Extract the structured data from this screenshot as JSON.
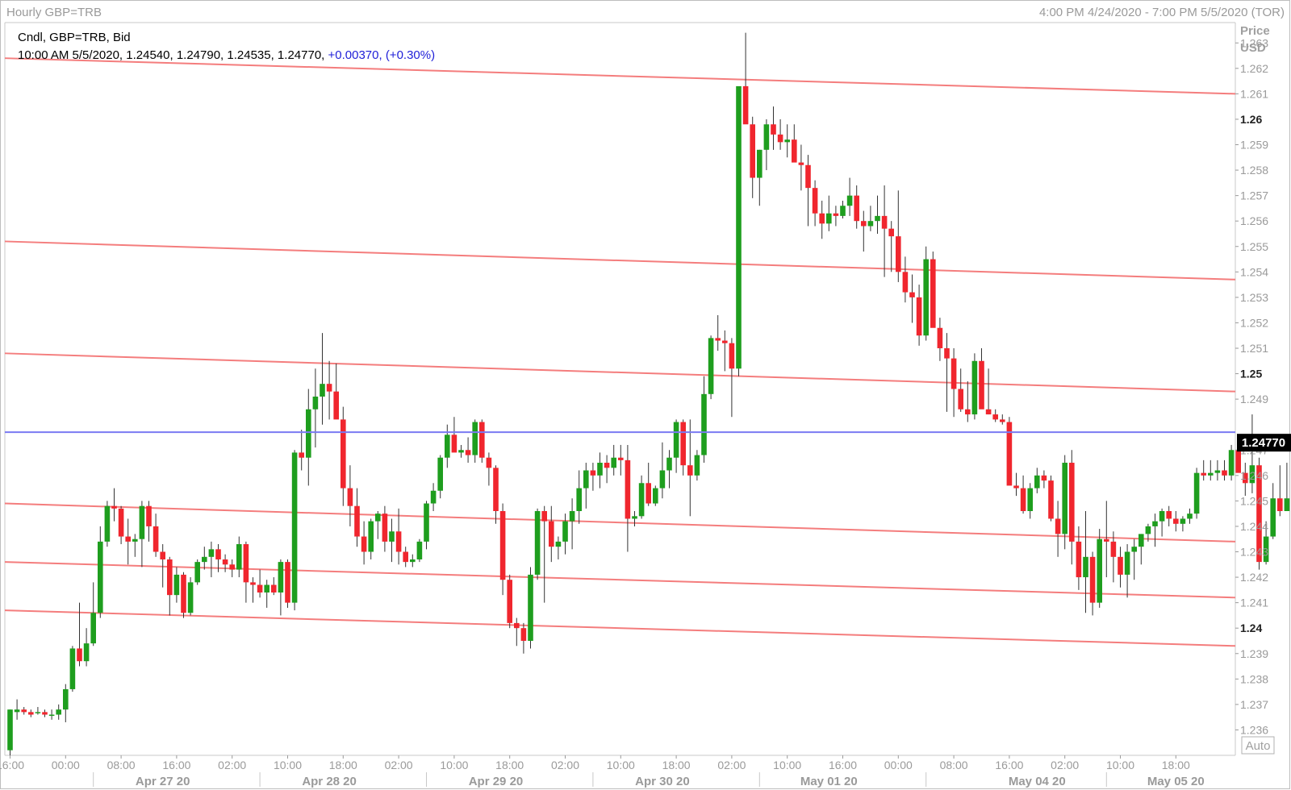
{
  "window": {
    "title": "Hourly GBP=TRB",
    "range": "4:00 PM 4/24/2020 - 7:00 PM 5/5/2020 (TOR)"
  },
  "legend": {
    "line1": "Cndl, GBP=TRB, Bid",
    "line2_prefix": "10:00 AM 5/5/2020, 1.24540, 1.24790, 1.24535, 1.24770, ",
    "change": "+0.00370, (+0.30%)"
  },
  "price_axis": {
    "title": "Price",
    "unit": "USD",
    "last_price_label": "1.24770",
    "auto_button": "Auto"
  },
  "colors": {
    "up": "#1e9e1e",
    "down": "#f0262e",
    "trendline": "#f47d7d",
    "last_price_line": "#7a7af2",
    "grid_text": "#808080",
    "change_text": "#1f1fd8"
  },
  "chart_data": {
    "type": "candlestick",
    "interval": "hourly",
    "instrument": "GBP=TRB",
    "ylim": [
      1.235,
      1.2638
    ],
    "y_ticks": [
      {
        "v": 1.263,
        "label": "1.263"
      },
      {
        "v": 1.262,
        "label": "1.262"
      },
      {
        "v": 1.261,
        "label": "1.261"
      },
      {
        "v": 1.26,
        "label": "1.26",
        "bold": true
      },
      {
        "v": 1.259,
        "label": "1.259"
      },
      {
        "v": 1.258,
        "label": "1.258"
      },
      {
        "v": 1.257,
        "label": "1.257"
      },
      {
        "v": 1.256,
        "label": "1.256"
      },
      {
        "v": 1.255,
        "label": "1.255"
      },
      {
        "v": 1.254,
        "label": "1.254"
      },
      {
        "v": 1.253,
        "label": "1.253"
      },
      {
        "v": 1.252,
        "label": "1.252"
      },
      {
        "v": 1.251,
        "label": "1.251"
      },
      {
        "v": 1.25,
        "label": "1.25",
        "bold": true
      },
      {
        "v": 1.249,
        "label": "1.249"
      },
      {
        "v": 1.247,
        "label": "1.247"
      },
      {
        "v": 1.246,
        "label": "1.246"
      },
      {
        "v": 1.245,
        "label": "1.245"
      },
      {
        "v": 1.244,
        "label": "1.244"
      },
      {
        "v": 1.243,
        "label": "1.243"
      },
      {
        "v": 1.242,
        "label": "1.242"
      },
      {
        "v": 1.241,
        "label": "1.241"
      },
      {
        "v": 1.24,
        "label": "1.24",
        "bold": true
      },
      {
        "v": 1.239,
        "label": "1.239"
      },
      {
        "v": 1.238,
        "label": "1.238"
      },
      {
        "v": 1.237,
        "label": "1.237"
      },
      {
        "v": 1.236,
        "label": "1.236"
      }
    ],
    "x_ticks": [
      {
        "i": 0,
        "label": "16:00"
      },
      {
        "i": 8,
        "label": "00:00"
      },
      {
        "i": 16,
        "label": "08:00"
      },
      {
        "i": 24,
        "label": "16:00"
      },
      {
        "i": 32,
        "label": "02:00"
      },
      {
        "i": 40,
        "label": "10:00"
      },
      {
        "i": 48,
        "label": "18:00"
      },
      {
        "i": 56,
        "label": "02:00"
      },
      {
        "i": 64,
        "label": "10:00"
      },
      {
        "i": 72,
        "label": "18:00"
      },
      {
        "i": 80,
        "label": "02:00"
      },
      {
        "i": 88,
        "label": "10:00"
      },
      {
        "i": 96,
        "label": "18:00"
      },
      {
        "i": 104,
        "label": "02:00"
      },
      {
        "i": 112,
        "label": "10:00"
      },
      {
        "i": 120,
        "label": "16:00"
      },
      {
        "i": 128,
        "label": "00:00"
      },
      {
        "i": 136,
        "label": "08:00"
      },
      {
        "i": 144,
        "label": "16:00"
      },
      {
        "i": 152,
        "label": "02:00"
      },
      {
        "i": 160,
        "label": "10:00"
      },
      {
        "i": 168,
        "label": "18:00"
      }
    ],
    "date_labels": [
      {
        "i": 22,
        "label": "Apr 27 20"
      },
      {
        "i": 46,
        "label": "Apr 28 20"
      },
      {
        "i": 70,
        "label": "Apr 29 20"
      },
      {
        "i": 94,
        "label": "Apr 30 20"
      },
      {
        "i": 118,
        "label": "May 01 20"
      },
      {
        "i": 148,
        "label": "May 04 20"
      },
      {
        "i": 168,
        "label": "May 05 20"
      }
    ],
    "day_separators": [
      12,
      36,
      60,
      84,
      108,
      132,
      158
    ],
    "last_price": 1.2477,
    "trendlines": [
      {
        "y1": 1.2624,
        "y2": 1.261
      },
      {
        "y1": 1.2552,
        "y2": 1.2537
      },
      {
        "y1": 1.2508,
        "y2": 1.2493
      },
      {
        "y1": 1.2449,
        "y2": 1.2434
      },
      {
        "y1": 1.2426,
        "y2": 1.2412
      },
      {
        "y1": 1.2407,
        "y2": 1.2393
      }
    ],
    "candles": [
      [
        1.2352,
        1.2368,
        1.235,
        1.2368
      ],
      [
        1.2367,
        1.2372,
        1.2364,
        1.2368
      ],
      [
        1.2368,
        1.2369,
        1.2366,
        1.2367
      ],
      [
        1.2367,
        1.2368,
        1.2365,
        1.2366
      ],
      [
        1.2367,
        1.2369,
        1.2366,
        1.2367
      ],
      [
        1.2367,
        1.2368,
        1.2365,
        1.2366
      ],
      [
        1.2366,
        1.2368,
        1.2364,
        1.2366
      ],
      [
        1.2366,
        1.237,
        1.2364,
        1.2368
      ],
      [
        1.2368,
        1.2378,
        1.2363,
        1.2376
      ],
      [
        1.2376,
        1.2393,
        1.2375,
        1.2392
      ],
      [
        1.2392,
        1.241,
        1.2385,
        1.2387
      ],
      [
        1.2387,
        1.24,
        1.2385,
        1.2394
      ],
      [
        1.2394,
        1.2418,
        1.2393,
        1.2406
      ],
      [
        1.2406,
        1.244,
        1.2404,
        1.2434
      ],
      [
        1.2434,
        1.245,
        1.2432,
        1.2448
      ],
      [
        1.2448,
        1.2455,
        1.2442,
        1.2447
      ],
      [
        1.2447,
        1.2448,
        1.2433,
        1.2436
      ],
      [
        1.2436,
        1.2443,
        1.2425,
        1.2434
      ],
      [
        1.2434,
        1.2437,
        1.2428,
        1.2435
      ],
      [
        1.2435,
        1.245,
        1.2424,
        1.2448
      ],
      [
        1.2448,
        1.245,
        1.2434,
        1.244
      ],
      [
        1.244,
        1.2445,
        1.2428,
        1.243
      ],
      [
        1.243,
        1.2433,
        1.2416,
        1.2427
      ],
      [
        1.2427,
        1.2428,
        1.2405,
        1.2413
      ],
      [
        1.2413,
        1.2424,
        1.241,
        1.2421
      ],
      [
        1.2421,
        1.2422,
        1.2404,
        1.2406
      ],
      [
        1.2406,
        1.242,
        1.2405,
        1.2418
      ],
      [
        1.2418,
        1.2427,
        1.2417,
        1.2426
      ],
      [
        1.2426,
        1.2432,
        1.2423,
        1.2428
      ],
      [
        1.2428,
        1.2434,
        1.242,
        1.2431
      ],
      [
        1.2431,
        1.2433,
        1.2422,
        1.2427
      ],
      [
        1.2427,
        1.2429,
        1.2422,
        1.2425
      ],
      [
        1.2425,
        1.2427,
        1.242,
        1.2423
      ],
      [
        1.2423,
        1.2436,
        1.242,
        1.2433
      ],
      [
        1.2433,
        1.2434,
        1.241,
        1.2418
      ],
      [
        1.2418,
        1.242,
        1.241,
        1.2417
      ],
      [
        1.2417,
        1.2423,
        1.2412,
        1.2414
      ],
      [
        1.2414,
        1.2419,
        1.2408,
        1.2417
      ],
      [
        1.2417,
        1.242,
        1.2413,
        1.2414
      ],
      [
        1.2414,
        1.2427,
        1.2405,
        1.2426
      ],
      [
        1.2426,
        1.2427,
        1.2408,
        1.241
      ],
      [
        1.241,
        1.247,
        1.2407,
        1.2469
      ],
      [
        1.2469,
        1.2478,
        1.2462,
        1.2467
      ],
      [
        1.2467,
        1.2494,
        1.2456,
        1.2486
      ],
      [
        1.2486,
        1.2502,
        1.2471,
        1.2491
      ],
      [
        1.2491,
        1.2516,
        1.248,
        1.2496
      ],
      [
        1.2496,
        1.2505,
        1.2482,
        1.2493
      ],
      [
        1.2493,
        1.2504,
        1.2486,
        1.2482
      ],
      [
        1.2482,
        1.2487,
        1.2448,
        1.2455
      ],
      [
        1.2455,
        1.2464,
        1.244,
        1.2448
      ],
      [
        1.2448,
        1.2455,
        1.2432,
        1.2436
      ],
      [
        1.2436,
        1.2442,
        1.2425,
        1.243
      ],
      [
        1.243,
        1.2443,
        1.2427,
        1.2442
      ],
      [
        1.2442,
        1.2446,
        1.2435,
        1.2445
      ],
      [
        1.2445,
        1.2448,
        1.243,
        1.2434
      ],
      [
        1.2434,
        1.2443,
        1.2426,
        1.2438
      ],
      [
        1.2438,
        1.2447,
        1.2425,
        1.243
      ],
      [
        1.243,
        1.2432,
        1.2424,
        1.2426
      ],
      [
        1.2426,
        1.2429,
        1.2424,
        1.2427
      ],
      [
        1.2427,
        1.2435,
        1.2426,
        1.2434
      ],
      [
        1.2434,
        1.245,
        1.2431,
        1.2449
      ],
      [
        1.2449,
        1.2457,
        1.2446,
        1.2454
      ],
      [
        1.2454,
        1.2468,
        1.2451,
        1.2467
      ],
      [
        1.2467,
        1.248,
        1.2463,
        1.2476
      ],
      [
        1.2476,
        1.2483,
        1.247,
        1.2469
      ],
      [
        1.2469,
        1.2472,
        1.2467,
        1.247
      ],
      [
        1.247,
        1.2475,
        1.2465,
        1.2468
      ],
      [
        1.2468,
        1.2482,
        1.2465,
        1.2481
      ],
      [
        1.2481,
        1.2482,
        1.2465,
        1.2467
      ],
      [
        1.2467,
        1.2469,
        1.2456,
        1.2463
      ],
      [
        1.2463,
        1.2464,
        1.2441,
        1.2446
      ],
      [
        1.2446,
        1.2449,
        1.2413,
        1.2419
      ],
      [
        1.2419,
        1.2421,
        1.24,
        1.2402
      ],
      [
        1.2402,
        1.2404,
        1.2393,
        1.24
      ],
      [
        1.24,
        1.2402,
        1.239,
        1.2395
      ],
      [
        1.2395,
        1.2424,
        1.2392,
        1.2421
      ],
      [
        1.2421,
        1.2447,
        1.2419,
        1.2446
      ],
      [
        1.2446,
        1.2448,
        1.241,
        1.2442
      ],
      [
        1.2442,
        1.2448,
        1.2426,
        1.2432
      ],
      [
        1.2432,
        1.2436,
        1.2427,
        1.2434
      ],
      [
        1.2434,
        1.2445,
        1.2429,
        1.2442
      ],
      [
        1.2442,
        1.2451,
        1.2431,
        1.2446
      ],
      [
        1.2446,
        1.2462,
        1.2441,
        1.2455
      ],
      [
        1.2455,
        1.2465,
        1.2447,
        1.2462
      ],
      [
        1.2462,
        1.2465,
        1.2454,
        1.246
      ],
      [
        1.246,
        1.2469,
        1.2455,
        1.2465
      ],
      [
        1.2465,
        1.2468,
        1.2457,
        1.2463
      ],
      [
        1.2463,
        1.2472,
        1.246,
        1.2467
      ],
      [
        1.2467,
        1.2472,
        1.246,
        1.2466
      ],
      [
        1.2466,
        1.2472,
        1.243,
        1.2443
      ],
      [
        1.2443,
        1.2446,
        1.244,
        1.2444
      ],
      [
        1.2444,
        1.246,
        1.2443,
        1.2457
      ],
      [
        1.2457,
        1.2465,
        1.2448,
        1.2449
      ],
      [
        1.2449,
        1.2456,
        1.2448,
        1.2455
      ],
      [
        1.2455,
        1.2473,
        1.2451,
        1.2462
      ],
      [
        1.2462,
        1.247,
        1.2455,
        1.2467
      ],
      [
        1.2467,
        1.2482,
        1.2461,
        1.2481
      ],
      [
        1.2481,
        1.2482,
        1.246,
        1.2464
      ],
      [
        1.2464,
        1.2482,
        1.2444,
        1.246
      ],
      [
        1.246,
        1.247,
        1.2458,
        1.2468
      ],
      [
        1.2468,
        1.2499,
        1.2465,
        1.2492
      ],
      [
        1.2492,
        1.2515,
        1.249,
        1.2514
      ],
      [
        1.2514,
        1.2523,
        1.2509,
        1.2513
      ],
      [
        1.2513,
        1.2517,
        1.2501,
        1.2512
      ],
      [
        1.2512,
        1.2514,
        1.2483,
        1.2502
      ],
      [
        1.2502,
        1.255,
        1.2499,
        1.2613
      ],
      [
        1.2613,
        1.2634,
        1.2605,
        1.2598
      ],
      [
        1.2598,
        1.2601,
        1.2569,
        1.2577
      ],
      [
        1.2577,
        1.2588,
        1.2566,
        1.2588
      ],
      [
        1.2588,
        1.26,
        1.258,
        1.2598
      ],
      [
        1.2598,
        1.2605,
        1.2588,
        1.2594
      ],
      [
        1.2594,
        1.26,
        1.2588,
        1.2591
      ],
      [
        1.2591,
        1.2598,
        1.2585,
        1.2592
      ],
      [
        1.2592,
        1.2598,
        1.2584,
        1.2583
      ],
      [
        1.2583,
        1.259,
        1.2572,
        1.2582
      ],
      [
        1.2582,
        1.2586,
        1.2558,
        1.2573
      ],
      [
        1.2573,
        1.2576,
        1.2558,
        1.2563
      ],
      [
        1.2563,
        1.2568,
        1.2553,
        1.2559
      ],
      [
        1.2559,
        1.257,
        1.2556,
        1.2563
      ],
      [
        1.2563,
        1.2566,
        1.2558,
        1.2562
      ],
      [
        1.2562,
        1.2568,
        1.2561,
        1.2566
      ],
      [
        1.2566,
        1.2577,
        1.2562,
        1.257
      ],
      [
        1.257,
        1.2574,
        1.2557,
        1.256
      ],
      [
        1.256,
        1.2564,
        1.2548,
        1.2558
      ],
      [
        1.2558,
        1.2566,
        1.2556,
        1.256
      ],
      [
        1.256,
        1.257,
        1.2555,
        1.2562
      ],
      [
        1.2562,
        1.2574,
        1.2538,
        1.2557
      ],
      [
        1.2557,
        1.256,
        1.254,
        1.2554
      ],
      [
        1.2554,
        1.2572,
        1.2536,
        1.254
      ],
      [
        1.254,
        1.2546,
        1.2528,
        1.2532
      ],
      [
        1.2532,
        1.2539,
        1.252,
        1.253
      ],
      [
        1.253,
        1.2535,
        1.2511,
        1.2515
      ],
      [
        1.2515,
        1.255,
        1.2513,
        1.2545
      ],
      [
        1.2545,
        1.2548,
        1.252,
        1.2518
      ],
      [
        1.2518,
        1.2522,
        1.2505,
        1.251
      ],
      [
        1.251,
        1.2516,
        1.2485,
        1.2506
      ],
      [
        1.2506,
        1.251,
        1.2483,
        1.2494
      ],
      [
        1.2494,
        1.2502,
        1.2485,
        1.2486
      ],
      [
        1.2486,
        1.2497,
        1.2481,
        1.2484
      ],
      [
        1.2484,
        1.2508,
        1.2482,
        1.2505
      ],
      [
        1.2505,
        1.251,
        1.2487,
        1.2486
      ],
      [
        1.2486,
        1.2502,
        1.2484,
        1.2484
      ],
      [
        1.2484,
        1.2486,
        1.2481,
        1.2482
      ],
      [
        1.2482,
        1.2484,
        1.248,
        1.2481
      ],
      [
        1.2481,
        1.2483,
        1.2457,
        1.2456
      ],
      [
        1.2456,
        1.2461,
        1.2452,
        1.2455
      ],
      [
        1.2455,
        1.246,
        1.2445,
        1.2446
      ],
      [
        1.2446,
        1.2457,
        1.2443,
        1.2455
      ],
      [
        1.2455,
        1.2463,
        1.2453,
        1.246
      ],
      [
        1.246,
        1.2462,
        1.2455,
        1.2458
      ],
      [
        1.2458,
        1.246,
        1.2442,
        1.2443
      ],
      [
        1.2443,
        1.245,
        1.2428,
        1.2437
      ],
      [
        1.2437,
        1.2468,
        1.2431,
        1.2465
      ],
      [
        1.2465,
        1.247,
        1.2425,
        1.2434
      ],
      [
        1.2434,
        1.244,
        1.2415,
        1.242
      ],
      [
        1.242,
        1.2446,
        1.2406,
        1.2428
      ],
      [
        1.2428,
        1.243,
        1.2405,
        1.241
      ],
      [
        1.241,
        1.2439,
        1.2408,
        1.2435
      ],
      [
        1.2435,
        1.245,
        1.242,
        1.2434
      ],
      [
        1.2434,
        1.2438,
        1.2418,
        1.2428
      ],
      [
        1.2428,
        1.2432,
        1.2416,
        1.2421
      ],
      [
        1.2421,
        1.2433,
        1.2412,
        1.243
      ],
      [
        1.243,
        1.2435,
        1.2419,
        1.2432
      ],
      [
        1.2432,
        1.2437,
        1.2425,
        1.2437
      ],
      [
        1.2437,
        1.2441,
        1.2434,
        1.244
      ],
      [
        1.244,
        1.2445,
        1.2432,
        1.2442
      ],
      [
        1.2442,
        1.2447,
        1.2436,
        1.2446
      ],
      [
        1.2446,
        1.2448,
        1.244,
        1.2443
      ],
      [
        1.2443,
        1.2446,
        1.2438,
        1.2441
      ],
      [
        1.2441,
        1.2444,
        1.2438,
        1.2443
      ],
      [
        1.2443,
        1.2447,
        1.2441,
        1.2445
      ],
      [
        1.2445,
        1.2463,
        1.2443,
        1.2461
      ],
      [
        1.2461,
        1.2466,
        1.2458,
        1.246
      ],
      [
        1.246,
        1.2466,
        1.2458,
        1.2461
      ],
      [
        1.2461,
        1.2466,
        1.2458,
        1.2462
      ],
      [
        1.2462,
        1.2466,
        1.2458,
        1.246
      ],
      [
        1.246,
        1.2472,
        1.2458,
        1.247
      ],
      [
        1.247,
        1.2473,
        1.2462,
        1.2461
      ],
      [
        1.2461,
        1.2465,
        1.2452,
        1.2457
      ],
      [
        1.2457,
        1.2484,
        1.2453,
        1.2464
      ],
      [
        1.2464,
        1.2467,
        1.2423,
        1.2426
      ],
      [
        1.2426,
        1.2442,
        1.2425,
        1.2436
      ],
      [
        1.2436,
        1.2457,
        1.2435,
        1.2451
      ],
      [
        1.2451,
        1.2464,
        1.2444,
        1.2446
      ],
      [
        1.2446,
        1.2465,
        1.2446,
        1.2451
      ],
      [
        1.2451,
        1.2472,
        1.2451,
        1.2477
      ]
    ]
  }
}
